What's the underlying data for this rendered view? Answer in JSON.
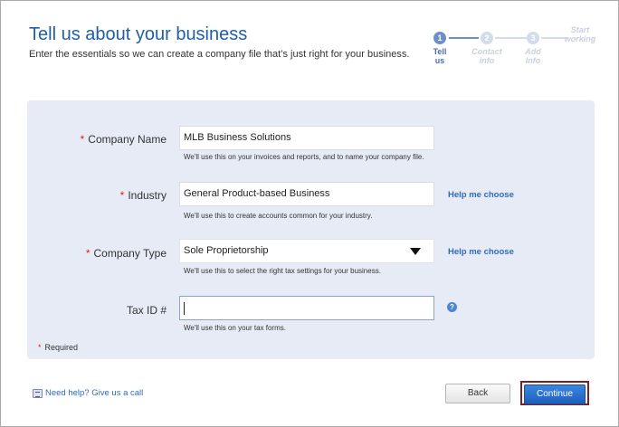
{
  "header": {
    "title": "Tell us about your business",
    "subtitle": "Enter the essentials so we can create a company file that’s just right for your business."
  },
  "stepper": {
    "steps": [
      {
        "number": "1",
        "label_line1": "Tell",
        "label_line2": "us"
      },
      {
        "number": "2",
        "label_line1": "Contact",
        "label_line2": "info"
      },
      {
        "number": "3",
        "label_line1": "Add",
        "label_line2": "info"
      },
      {
        "number": "",
        "label_line1": "Start",
        "label_line2": "working"
      }
    ]
  },
  "form": {
    "required_marker": "*",
    "company_name": {
      "label": "Company Name",
      "value": "MLB Business Solutions",
      "hint": "We'll use this on your invoices and reports, and to name your company file."
    },
    "industry": {
      "label": "Industry",
      "value": "General Product-based Business",
      "hint": "We'll use this to create accounts common for your industry.",
      "help_link": "Help me choose"
    },
    "company_type": {
      "label": "Company Type",
      "value": "Sole Proprietorship",
      "hint": "We'll use this to select the right tax settings for your business.",
      "help_link": "Help me choose"
    },
    "tax_id": {
      "label": "Tax ID #",
      "value": "",
      "hint": "We'll use this on your tax forms.",
      "help_icon": "?"
    },
    "required_note": "Required"
  },
  "footer": {
    "help_call": "Need help? Give us a call",
    "back_label": "Back",
    "continue_label": "Continue"
  }
}
